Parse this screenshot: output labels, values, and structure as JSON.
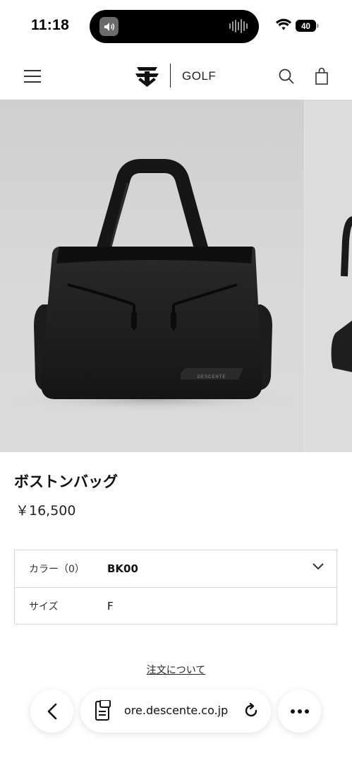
{
  "status_bar": {
    "time": "11:18",
    "battery": "40",
    "icons": [
      "speaker-icon",
      "waveform-icon",
      "wifi-icon",
      "battery-icon"
    ]
  },
  "header": {
    "brand": "GOLF",
    "icons": [
      "menu-icon",
      "descente-logo",
      "search-icon",
      "shopping-bag-icon"
    ]
  },
  "product": {
    "name": "ボストンバッグ",
    "price": "￥16,500",
    "image_brand_print": "DESCENTE"
  },
  "options": [
    {
      "label": "カラー（0）",
      "value": "BK00",
      "expandable": true
    },
    {
      "label": "サイズ",
      "value": "F",
      "expandable": false
    }
  ],
  "order_link": "注文について",
  "browser": {
    "url": "ore.descente.co.jp",
    "icons": [
      "back-icon",
      "page-icon",
      "reload-icon",
      "more-icon"
    ]
  },
  "colors": {
    "background": "#ffffff",
    "text": "#1a1a1a",
    "border": "#d6d6d6",
    "photo_background": "#d4d4d4"
  }
}
